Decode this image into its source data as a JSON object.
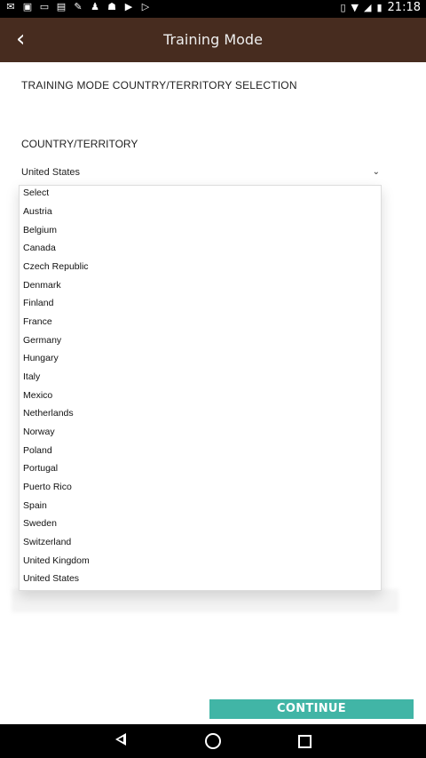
{
  "status_bar": {
    "time": "21:18",
    "left_icons": [
      "gmail-icon",
      "flipboard-icon",
      "card-icon",
      "news-icon",
      "wrench-icon",
      "person-icon",
      "android-icon",
      "play-store-icon",
      "play-movies-icon"
    ],
    "right_icons": [
      "vibrate-icon",
      "wifi-icon",
      "signal-icon",
      "battery-icon"
    ]
  },
  "header": {
    "title": "Training Mode"
  },
  "page": {
    "section_title": "TRAINING MODE COUNTRY/TERRITORY SELECTION",
    "country_label": "COUNTRY/TERRITORY",
    "selected_value": "United States"
  },
  "dropdown": {
    "options": [
      "Select",
      "Austria",
      "Belgium",
      "Canada",
      "Czech Republic",
      "Denmark",
      "Finland",
      "France",
      "Germany",
      "Hungary",
      "Italy",
      "Mexico",
      "Netherlands",
      "Norway",
      "Poland",
      "Portugal",
      "Puerto Rico",
      "Spain",
      "Sweden",
      "Switzerland",
      "United Kingdom",
      "United States"
    ]
  },
  "actions": {
    "continue_label": "CONTINUE"
  },
  "colors": {
    "appbar": "#472c1f",
    "accent": "#41b5a6"
  }
}
